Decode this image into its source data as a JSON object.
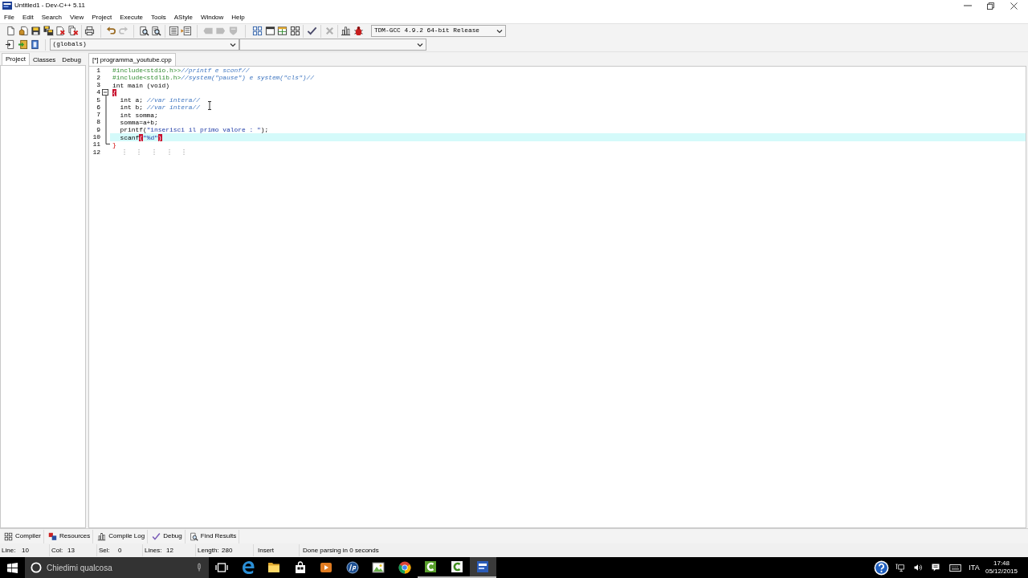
{
  "window": {
    "title": "Untitled1 - Dev-C++ 5.11"
  },
  "menu": [
    "File",
    "Edit",
    "Search",
    "View",
    "Project",
    "Execute",
    "Tools",
    "AStyle",
    "Window",
    "Help"
  ],
  "toolbar_main": {
    "groups": [
      [
        {
          "disabled": false
        },
        {
          "disabled": false
        },
        {
          "disabled": false
        },
        {
          "disabled": false
        },
        {
          "disabled": false
        },
        {
          "disabled": false
        }
      ],
      [
        {
          "disabled": false
        }
      ],
      [
        {
          "disabled": false
        },
        {
          "disabled": true
        }
      ],
      [
        {
          "disabled": false
        },
        {
          "disabled": false
        }
      ],
      [
        {
          "disabled": false
        },
        {
          "disabled": false
        }
      ],
      [
        {
          "disabled": true
        },
        {
          "disabled": true
        },
        {
          "disabled": true
        }
      ],
      [
        {
          "disabled": false
        },
        {
          "disabled": false
        },
        {
          "disabled": false
        },
        {
          "disabled": false
        }
      ],
      [
        {
          "disabled": false
        }
      ],
      [
        {
          "disabled": true
        }
      ],
      [
        {
          "disabled": false
        },
        {
          "disabled": false
        }
      ]
    ],
    "compiler": "TDM-GCC 4.9.2 64-bit Release"
  },
  "toolbar_class": {
    "groups": [
      [
        {
          "disabled": false
        },
        {
          "disabled": false
        },
        {
          "disabled": false
        }
      ]
    ],
    "scope": "(globals)"
  },
  "left_panel": {
    "tabs": [
      {
        "label": "Project",
        "selected": true
      },
      {
        "label": "Classes",
        "selected": false
      },
      {
        "label": "Debug",
        "selected": false
      }
    ]
  },
  "editor": {
    "tabs": [
      {
        "label": "[*] programma_youtube.cpp",
        "selected": true
      }
    ],
    "lines": [
      {
        "number": "1",
        "selected": false,
        "tokens": [
          {
            "kind": "preprocessor",
            "text": "#include<stdio.h>>"
          },
          {
            "kind": "comment",
            "text": "//printf e sconf//"
          }
        ]
      },
      {
        "number": "2",
        "selected": false,
        "tokens": [
          {
            "kind": "preprocessor",
            "text": "#include<stdlib.h>"
          },
          {
            "kind": "comment",
            "text": "//system(\"pause\") e system(\"cls\")//"
          }
        ]
      },
      {
        "number": "3",
        "selected": false,
        "tokens": [
          {
            "kind": "plain",
            "text": "int main (void)"
          }
        ]
      },
      {
        "number": "4",
        "selected": false,
        "expanded": true,
        "tokens": [
          {
            "kind": "brace_match",
            "text": "{"
          }
        ],
        "children": [
          {
            "number": "5",
            "selected": false,
            "tokens": [
              {
                "kind": "plain",
                "text": "  int a; "
              },
              {
                "kind": "comment",
                "text": "//var intera//"
              }
            ]
          },
          {
            "number": "6",
            "selected": false,
            "tokens": [
              {
                "kind": "plain",
                "text": "  int b; "
              },
              {
                "kind": "comment",
                "text": "//var intera//"
              }
            ]
          },
          {
            "number": "7",
            "selected": false,
            "tokens": [
              {
                "kind": "plain",
                "text": "  int somma;"
              }
            ]
          },
          {
            "number": "8",
            "selected": false,
            "tokens": [
              {
                "kind": "plain",
                "text": "  somma=a+b;"
              }
            ]
          },
          {
            "number": "9",
            "selected": false,
            "tokens": [
              {
                "kind": "plain",
                "text": "  printf("
              },
              {
                "kind": "string",
                "text": "\"inserisci il primo valore : \""
              },
              {
                "kind": "plain",
                "text": ");"
              }
            ]
          },
          {
            "number": "10",
            "selected": true,
            "tokens": [
              {
                "kind": "plain",
                "text": "  scanf"
              },
              {
                "kind": "brace_match",
                "text": "("
              },
              {
                "kind": "string",
                "text": "\"%d\""
              },
              {
                "kind": "brace_match",
                "text": ")"
              }
            ]
          },
          {
            "number": "11",
            "selected": false,
            "tokens": [
              {
                "kind": "brace",
                "text": "}"
              }
            ]
          }
        ]
      },
      {
        "number": "12",
        "selected": false,
        "indent_guides": true
      }
    ]
  },
  "bottom_tabs": [
    {
      "label": "Compiler",
      "selected": false
    },
    {
      "label": "Resources",
      "selected": false
    },
    {
      "label": "Compile Log",
      "selected": false
    },
    {
      "label": "Debug",
      "selected": false
    },
    {
      "label": "Find Results",
      "selected": false
    }
  ],
  "status_bar": {
    "fields": [
      {
        "label": "Line:",
        "value": "10"
      },
      {
        "label": "Col:",
        "value": "13"
      },
      {
        "label": "Sel:",
        "value": "0"
      },
      {
        "label": "Lines:",
        "value": "12"
      },
      {
        "label": "Length:",
        "value": "280"
      }
    ],
    "mode": "Insert",
    "message": "Done parsing in 0 seconds"
  },
  "taskbar": {
    "search": {
      "placeholder": "Chiedimi qualcosa"
    },
    "apps": [
      {
        "running": false,
        "selected": false
      },
      {
        "running": false,
        "selected": false
      },
      {
        "running": false,
        "selected": false
      },
      {
        "running": false,
        "selected": false
      },
      {
        "running": false,
        "selected": false
      },
      {
        "running": false,
        "selected": false
      },
      {
        "running": false,
        "selected": false
      },
      {
        "running": false,
        "selected": false
      },
      {
        "running": true,
        "selected": false
      },
      {
        "running": true,
        "selected": false
      },
      {
        "running": true,
        "selected": true
      }
    ],
    "language": "ITA",
    "time": "17:48",
    "date": "05/12/2015"
  }
}
